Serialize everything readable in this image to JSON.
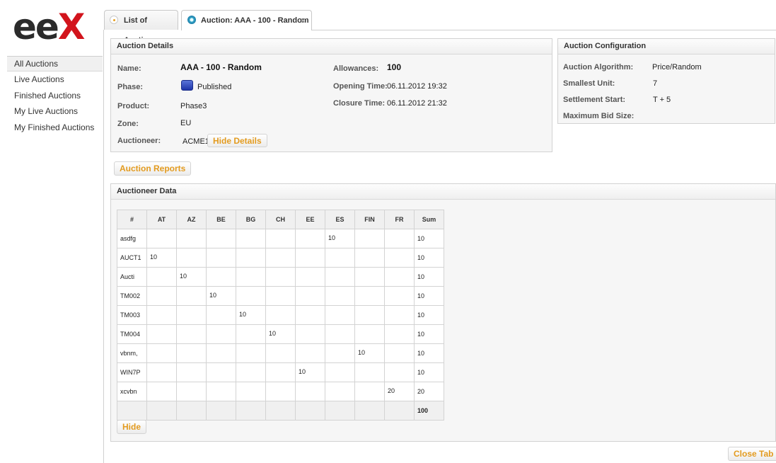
{
  "logo": {
    "text_e": "ee",
    "text_x": "X"
  },
  "nav": {
    "items": [
      {
        "label": "All Auctions"
      },
      {
        "label": "Live Auctions"
      },
      {
        "label": "Finished Auctions"
      },
      {
        "label": "My Live Auctions"
      },
      {
        "label": "My Finished Auctions"
      }
    ]
  },
  "tabs": [
    {
      "label": "List of Auctions"
    },
    {
      "label": "Auction: AAA - 100 - Random",
      "close": "✕"
    }
  ],
  "auction_details": {
    "title": "Auction Details",
    "name_label": "Name:",
    "name": "AAA - 100 - Random",
    "phase_label": "Phase:",
    "phase": "Published",
    "product_label": "Product:",
    "product": "Phase3",
    "zone_label": "Zone:",
    "zone": "EU",
    "auctioneer_label": "Auctioneer:",
    "auctioneer": "ACME1",
    "hide_details": "Hide Details",
    "allowances_label": "Allowances:",
    "allowances": "100",
    "opening_label": "Opening Time:",
    "opening": "06.11.2012 19:32",
    "closure_label": "Closure Time:",
    "closure": "06.11.2012 21:32",
    "phase_color": "#2a44b8"
  },
  "auction_config": {
    "title": "Auction Configuration",
    "algorithm_label": "Auction Algorithm:",
    "algorithm": "Price/Random",
    "smallest_unit_label": "Smallest Unit:",
    "smallest_unit": "7",
    "settlement_label": "Settlement Start:",
    "settlement": "T + 5",
    "max_bid_label": "Maximum Bid Size:",
    "max_bid": ""
  },
  "auction_reports": "Auction Reports",
  "auctioneer_data": {
    "title": "Auctioneer Data",
    "columns": [
      "#",
      "AT",
      "AZ",
      "BE",
      "BG",
      "CH",
      "EE",
      "ES",
      "FIN",
      "FR",
      "Sum"
    ],
    "rows": [
      [
        "asdfg",
        "",
        "",
        "",
        "",
        "",
        "",
        "10",
        "",
        "",
        "10"
      ],
      [
        "AUCT1",
        "10",
        "",
        "",
        "",
        "",
        "",
        "",
        "",
        "",
        "10"
      ],
      [
        "Aucti",
        "",
        "10",
        "",
        "",
        "",
        "",
        "",
        "",
        "",
        "10"
      ],
      [
        "TM002",
        "",
        "",
        "10",
        "",
        "",
        "",
        "",
        "",
        "",
        "10"
      ],
      [
        "TM003",
        "",
        "",
        "",
        "10",
        "",
        "",
        "",
        "",
        "",
        "10"
      ],
      [
        "TM004",
        "",
        "",
        "",
        "",
        "10",
        "",
        "",
        "",
        "",
        "10"
      ],
      [
        "vbnm,",
        "",
        "",
        "",
        "",
        "",
        "",
        "",
        "10",
        "",
        "10"
      ],
      [
        "WIN7P",
        "",
        "",
        "",
        "",
        "",
        "10",
        "",
        "",
        "",
        "10"
      ],
      [
        "xcvbn",
        "",
        "",
        "",
        "",
        "",
        "",
        "",
        "",
        "20",
        "20"
      ]
    ],
    "total": "100",
    "hide": "Hide"
  },
  "close_tab": "Close Tab",
  "colors": {
    "accent": "#e39b1f",
    "logo_red": "#d2141c"
  }
}
